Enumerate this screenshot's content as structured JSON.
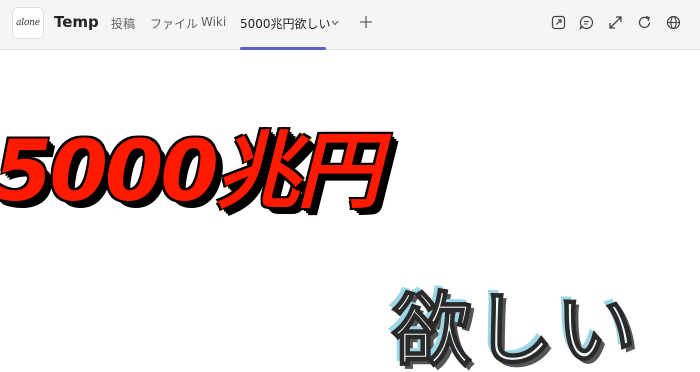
{
  "header": {
    "avatar_text": "alone",
    "channel_title": "Temp",
    "tabs": [
      {
        "label": "投稿"
      },
      {
        "label": "ファイル"
      },
      {
        "label": "Wiki"
      },
      {
        "label": "5000兆円欲しい"
      }
    ],
    "add_tab_icon": "plus-icon",
    "actions": [
      {
        "icon": "popout-icon"
      },
      {
        "icon": "chat-icon"
      },
      {
        "icon": "expand-icon"
      },
      {
        "icon": "refresh-icon"
      },
      {
        "icon": "globe-icon"
      }
    ],
    "accent_color": "#5b5fc7"
  },
  "content": {
    "line1": "5000兆円",
    "line2": "欲しい",
    "line1_fill": "#ff1a00",
    "line1_stroke": "#ffd22a"
  }
}
